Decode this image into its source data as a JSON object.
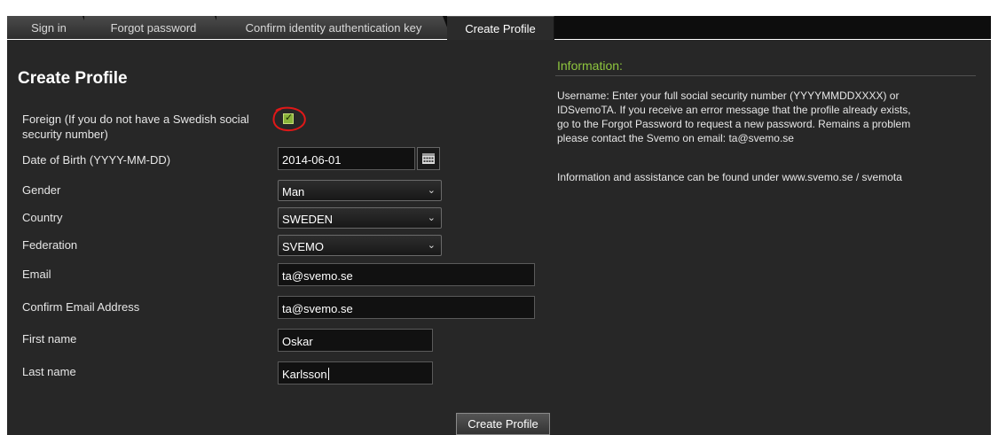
{
  "tabs": [
    {
      "label": "Sign in"
    },
    {
      "label": "Forgot password"
    },
    {
      "label": "Confirm identity authentication key"
    },
    {
      "label": "Create Profile",
      "active": true
    }
  ],
  "form": {
    "title": "Create Profile",
    "foreign_label_line1": "Foreign (If you do not have a Swedish social",
    "foreign_label_line2": "security number)",
    "foreign_checked": true,
    "dob_label": "Date of Birth (YYYY-MM-DD)",
    "dob_value": "2014-06-01",
    "gender_label": "Gender",
    "gender_value": "Man",
    "country_label": "Country",
    "country_value": "SWEDEN",
    "federation_label": "Federation",
    "federation_value": "SVEMO",
    "email_label": "Email",
    "email_value": "ta@svemo.se",
    "confirm_email_label": "Confirm Email Address",
    "confirm_email_value": "ta@svemo.se",
    "first_name_label": "First name",
    "first_name_value": "Oskar",
    "last_name_label": "Last name",
    "last_name_value": "Karlsson",
    "submit_label": "Create Profile"
  },
  "info": {
    "title": "Information:",
    "paragraph1_line1": "Username: Enter your full social security number (YYYYMMDDXXXX) or",
    "paragraph1_line2": "IDSvemoTA. If you receive an error message that the profile already exists,",
    "paragraph1_line3": "go to the Forgot Password to request a new password. Remains a problem",
    "paragraph1_line4": "please contact the Svemo on email: ta@svemo.se",
    "paragraph2": "Information and assistance can be found under www.svemo.se / svemota"
  },
  "colors": {
    "panel_bg": "#272727",
    "accent_green": "#8fc73e",
    "annotation_red": "#e01818"
  },
  "icons": {
    "calendar": "calendar-icon",
    "dropdown": "chevron-down-icon",
    "check": "checkmark-icon"
  }
}
